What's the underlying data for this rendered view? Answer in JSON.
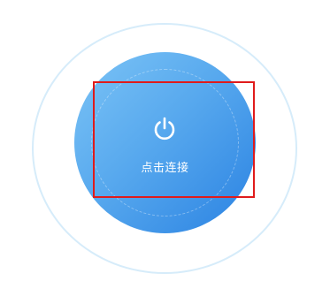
{
  "connect": {
    "label": "点击连接",
    "icon": "power-icon"
  },
  "colors": {
    "ring": "#d6ecfa",
    "gradient_start": "#7cc4f6",
    "gradient_end": "#2a82e2",
    "highlight": "#e01b1b"
  }
}
